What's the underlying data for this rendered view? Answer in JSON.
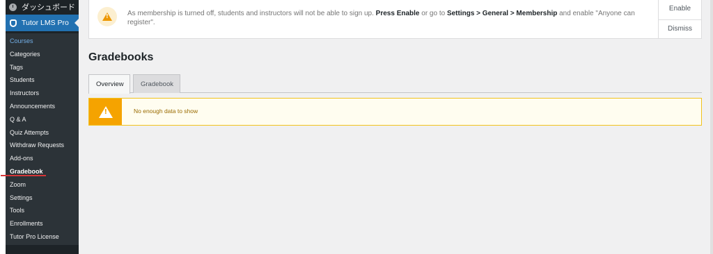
{
  "sidebar": {
    "dashboard_label": "ダッシュボード",
    "plugin_label": "Tutor LMS Pro",
    "items": [
      {
        "label": "Courses"
      },
      {
        "label": "Categories"
      },
      {
        "label": "Tags"
      },
      {
        "label": "Students"
      },
      {
        "label": "Instructors"
      },
      {
        "label": "Announcements"
      },
      {
        "label": "Q & A"
      },
      {
        "label": "Quiz Attempts"
      },
      {
        "label": "Withdraw Requests"
      },
      {
        "label": "Add-ons"
      },
      {
        "label": "Gradebook"
      },
      {
        "label": "Zoom"
      },
      {
        "label": "Settings"
      },
      {
        "label": "Tools"
      },
      {
        "label": "Enrollments"
      },
      {
        "label": "Tutor Pro License"
      }
    ]
  },
  "notice": {
    "text_1": "As membership is turned off, students and instructors will not be able to sign up. ",
    "bold_1": "Press Enable",
    "text_2": " or go to ",
    "bold_2": "Settings > General > Membership",
    "text_3": " and enable \"Anyone can register\".",
    "enable_label": "Enable",
    "dismiss_label": "Dismiss"
  },
  "page": {
    "title": "Gradebooks",
    "tabs": [
      {
        "label": "Overview"
      },
      {
        "label": "Gradebook"
      }
    ],
    "alert_text": "No enough data to show"
  },
  "colors": {
    "sidebar_bg": "#1d2327",
    "accent": "#2271b1",
    "warning": "#f5a300"
  }
}
